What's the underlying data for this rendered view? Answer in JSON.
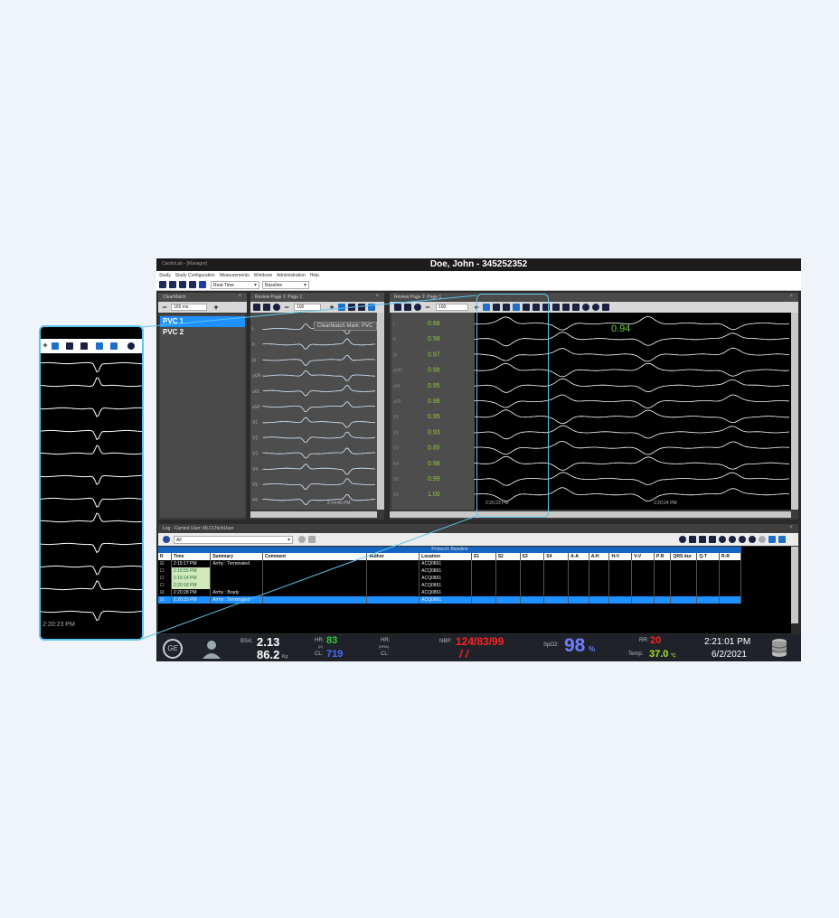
{
  "window": {
    "app_name": "CardioLab - [Manager]",
    "patient": "Doe, John - 345252352"
  },
  "menu": [
    "Study",
    "Study Configuration",
    "Measurements",
    "Windows",
    "Administration",
    "Help"
  ],
  "toolbar": {
    "mode": "Real-Time",
    "protocol": "Baseline"
  },
  "clearmatch": {
    "title": "ClearMatch",
    "speed": "165 ms",
    "items": [
      "PVC 1",
      "PVC 2"
    ]
  },
  "review1": {
    "title": "Review Page 1: Page 1",
    "zoom": "100",
    "mark_label": "ClearMatch Mark: PVC",
    "timestamp": "2:14:40 PM"
  },
  "review2": {
    "title": "Review Page 2: Page 1",
    "zoom": "100",
    "value_label": "0.94",
    "timestamp_left": "2:20:23 PM",
    "timestamp_right": "2:20:24 PM"
  },
  "leads": [
    "I",
    "II",
    "III",
    "aVR",
    "aVL",
    "aVF",
    "V1",
    "V2",
    "V3",
    "V4",
    "V5",
    "V6"
  ],
  "correlations": [
    "0.68",
    "0.98",
    "0.97",
    "0.98",
    "0.95",
    "0.98",
    "0.95",
    "0.93",
    "0.85",
    "0.98",
    "0.99",
    "1.00"
  ],
  "zoom": {
    "timestamp": "2:20:23 PM"
  },
  "log": {
    "title": "Log - Current User: MLCLTechUser",
    "filter": "All",
    "protocol_label": "Protocol: Baseline",
    "columns": [
      "R",
      "Time",
      "Summary",
      "Comment",
      "Author",
      "Location",
      "S1",
      "S2",
      "S3",
      "S4",
      "A-A",
      "A-H",
      "H-V",
      "V-V",
      "P-R",
      "QRS dur",
      "Q-T",
      "R-R"
    ],
    "rows": [
      {
        "checked": true,
        "time": "2:15:17 PM",
        "summary": "Arrhy : Terminated",
        "location": "ACQ0861",
        "highlight_time": false,
        "selected": false
      },
      {
        "checked": false,
        "time": "2:15:55 PM",
        "summary": "",
        "location": "ACQ0861",
        "highlight_time": true,
        "selected": false
      },
      {
        "checked": false,
        "time": "2:16:14 PM",
        "summary": "",
        "location": "ACQ0861",
        "highlight_time": true,
        "selected": false
      },
      {
        "checked": false,
        "time": "2:20:18 PM",
        "summary": "",
        "location": "ACQ0861",
        "highlight_time": true,
        "selected": false
      },
      {
        "checked": true,
        "time": "2:20:28 PM",
        "summary": "Arrhy : Brady",
        "location": "ACQ0861",
        "highlight_time": false,
        "selected": false
      },
      {
        "checked": true,
        "time": "2:20:33 PM",
        "summary": "Arrhy : Terminated",
        "location": "ACQ0861",
        "highlight_time": false,
        "selected": true
      }
    ]
  },
  "vitals": {
    "bsa_label": "BSA:",
    "bsa": "2.13",
    "weight": "86.2",
    "weight_unit": "Kg",
    "hr_label": "HR:",
    "hr_sub": "(II)",
    "hr": "83",
    "cl_label": "CL:",
    "cl": "719",
    "hr2_label": "HR:",
    "hr2_sub": "(HRA)",
    "cl2_label": "CL:",
    "nbp_label": "NBP:",
    "nbp": "124/83/99",
    "nbp_sub": "/ /",
    "spo2_label": "SpO2:",
    "spo2": "98",
    "spo2_unit": "%",
    "rr_label": "RR:",
    "rr": "20",
    "temp_label": "Temp:",
    "temp": "37.0",
    "temp_unit": "°C",
    "time": "2:21:01 PM",
    "date": "6/2/2021"
  },
  "colors": {
    "accent": "#5ec5ee",
    "selection": "#1e90ff",
    "hr": "#2ecc40",
    "cl": "#4a6cff",
    "nbp": "#ff2020",
    "spo2": "#6f7dff",
    "rr": "#ff2020",
    "temp": "#a7e22e",
    "correlation": "#8fce2e"
  }
}
